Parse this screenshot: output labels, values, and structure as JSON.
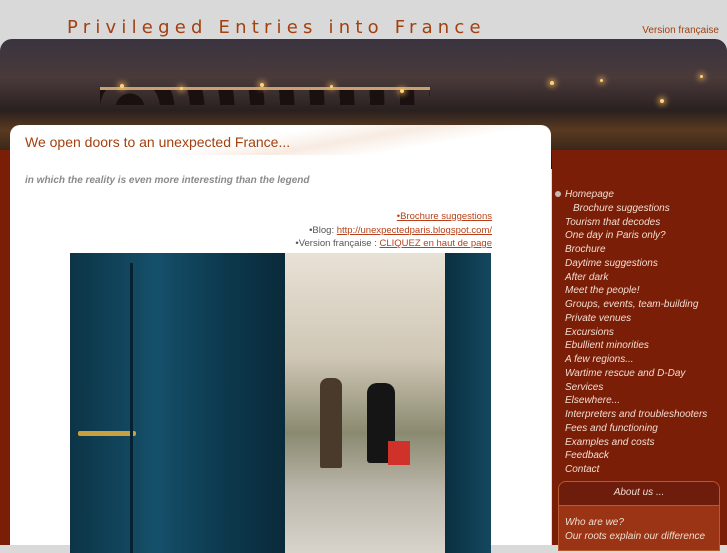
{
  "header": {
    "title": "Privileged Entries into France",
    "language_link": "Version française"
  },
  "main": {
    "title": "We open doors to an unexpected France...",
    "subtitle": "in which the reality is even more interesting than the legend",
    "links": [
      {
        "prefix": "",
        "label": "•Brochure suggestions"
      },
      {
        "prefix": "•Blog: ",
        "label": "http://unexpectedparis.blogspot.com/"
      },
      {
        "prefix": "•Version française : ",
        "label": "CLIQUEZ en haut de page"
      }
    ]
  },
  "sidebar": {
    "items": [
      "Homepage",
      "Brochure suggestions",
      "Tourism that decodes",
      "One day in Paris only?",
      "Brochure",
      "Daytime suggestions",
      "After dark",
      "Meet the people!",
      "Groups, events, team-building",
      "Private venues",
      "Excursions",
      "Ebullient minorities",
      "A few regions...",
      "Wartime rescue and D-Day",
      "Services",
      "Elsewhere...",
      "Interpreters and troubleshooters",
      "Fees and functioning",
      "Examples and costs",
      "Feedback",
      "Contact"
    ],
    "about": {
      "title": "About us ...",
      "items": [
        "Who are we?",
        "Our roots explain our difference"
      ]
    }
  },
  "colors": {
    "accent": "#a3400f",
    "sidebar": "#7a1e08"
  }
}
